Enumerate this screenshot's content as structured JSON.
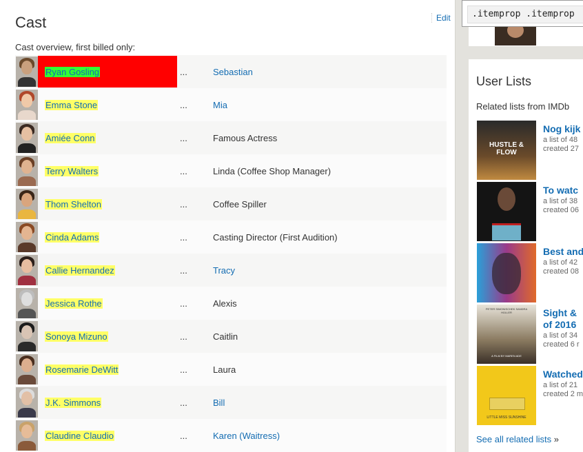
{
  "cast_panel": {
    "title": "Cast",
    "edit_label": "Edit",
    "overview_label": "Cast overview, first billed only:",
    "ellipsis": "...",
    "rows": [
      {
        "actor": "Ryan Gosling",
        "character": "Sebastian",
        "character_link": true,
        "selected": true,
        "skin": "#c9a07e",
        "hair": "#6b4a2c",
        "shirt": "#333333"
      },
      {
        "actor": "Emma Stone",
        "character": "Mia",
        "character_link": true,
        "selected": false,
        "skin": "#f0c9a8",
        "hair": "#b0472a",
        "shirt": "#e8d8cc"
      },
      {
        "actor": "Amiée Conn",
        "character": "Famous Actress",
        "character_link": false,
        "selected": false,
        "skin": "#e6c0a2",
        "hair": "#3a2a22",
        "shirt": "#222222"
      },
      {
        "actor": "Terry Walters",
        "character": "Linda (Coffee Shop Manager)",
        "character_link": false,
        "selected": false,
        "skin": "#e0b390",
        "hair": "#6a3f25",
        "shirt": "#9a6a50"
      },
      {
        "actor": "Thom Shelton",
        "character": "Coffee Spiller",
        "character_link": false,
        "selected": false,
        "skin": "#d9a57d",
        "hair": "#3a2618",
        "shirt": "#e9b640"
      },
      {
        "actor": "Cinda Adams",
        "character": "Casting Director (First Audition)",
        "character_link": false,
        "selected": false,
        "skin": "#e4b591",
        "hair": "#8a4a24",
        "shirt": "#5a3a2a"
      },
      {
        "actor": "Callie Hernandez",
        "character": "Tracy",
        "character_link": true,
        "selected": false,
        "skin": "#e8bda0",
        "hair": "#2c1f1a",
        "shirt": "#a03040"
      },
      {
        "actor": "Jessica Rothe",
        "character": "Alexis",
        "character_link": false,
        "selected": false,
        "skin": "#dedede",
        "hair": "#bdbdbd",
        "shirt": "#555555"
      },
      {
        "actor": "Sonoya Mizuno",
        "character": "Caitlin",
        "character_link": false,
        "selected": false,
        "skin": "#d9c4b4",
        "hair": "#1c1c1c",
        "shirt": "#2a2a2a"
      },
      {
        "actor": "Rosemarie DeWitt",
        "character": "Laura",
        "character_link": false,
        "selected": false,
        "skin": "#dcae8e",
        "hair": "#4a2e1e",
        "shirt": "#6a4a3a"
      },
      {
        "actor": "J.K. Simmons",
        "character": "Bill",
        "character_link": true,
        "selected": false,
        "skin": "#e2c0a6",
        "hair": "#dcdcdc",
        "shirt": "#3a3a4a"
      },
      {
        "actor": "Claudine Claudio",
        "character": "Karen (Waitress)",
        "character_link": true,
        "selected": false,
        "skin": "#e6bc98",
        "hair": "#c9a26a",
        "shirt": "#8a5a3a"
      }
    ]
  },
  "inspector": {
    "selector_text": ".itemprop .itemprop"
  },
  "user_lists": {
    "title": "User Lists",
    "subtitle": "Related lists from IMDb",
    "items": [
      {
        "title_line1": "Nog kijk",
        "title_line2": "",
        "meta1": "a list of 48",
        "meta2": "created 27",
        "poster": "hustle"
      },
      {
        "title_line1": "To watc",
        "title_line2": "",
        "meta1": "a list of 38",
        "meta2": "created 06",
        "poster": "gift"
      },
      {
        "title_line1": "Best and",
        "title_line2": "",
        "meta1": "a list of 42",
        "meta2": "created 08",
        "poster": "moonlight"
      },
      {
        "title_line1": "Sight &",
        "title_line2": "of 2016",
        "meta1": "a list of 34",
        "meta2": "created 6 r",
        "poster": "erdmann"
      },
      {
        "title_line1": "Watched",
        "title_line2": "",
        "meta1": "a list of 21",
        "meta2": "created 2 m",
        "poster": "sunshine"
      }
    ],
    "see_all_label": "See all related lists",
    "see_all_suffix": "»"
  },
  "poster_texts": {
    "hustle": "HUSTLE & FLOW",
    "moonlight": "",
    "erdmann_top": "PETER SIMONISCHEK SANDRA HÜLLER",
    "erdmann_bottom": "A FILM BY MAREN ADE",
    "sunshine": "LITTLE MISS SUNSHINE"
  },
  "colors": {
    "link": "#136cb2",
    "name_highlight": "#ffff66",
    "selected_highlight": "#33ff33",
    "selected_cell": "#ff0000",
    "page_bg": "#e3e2dd"
  }
}
